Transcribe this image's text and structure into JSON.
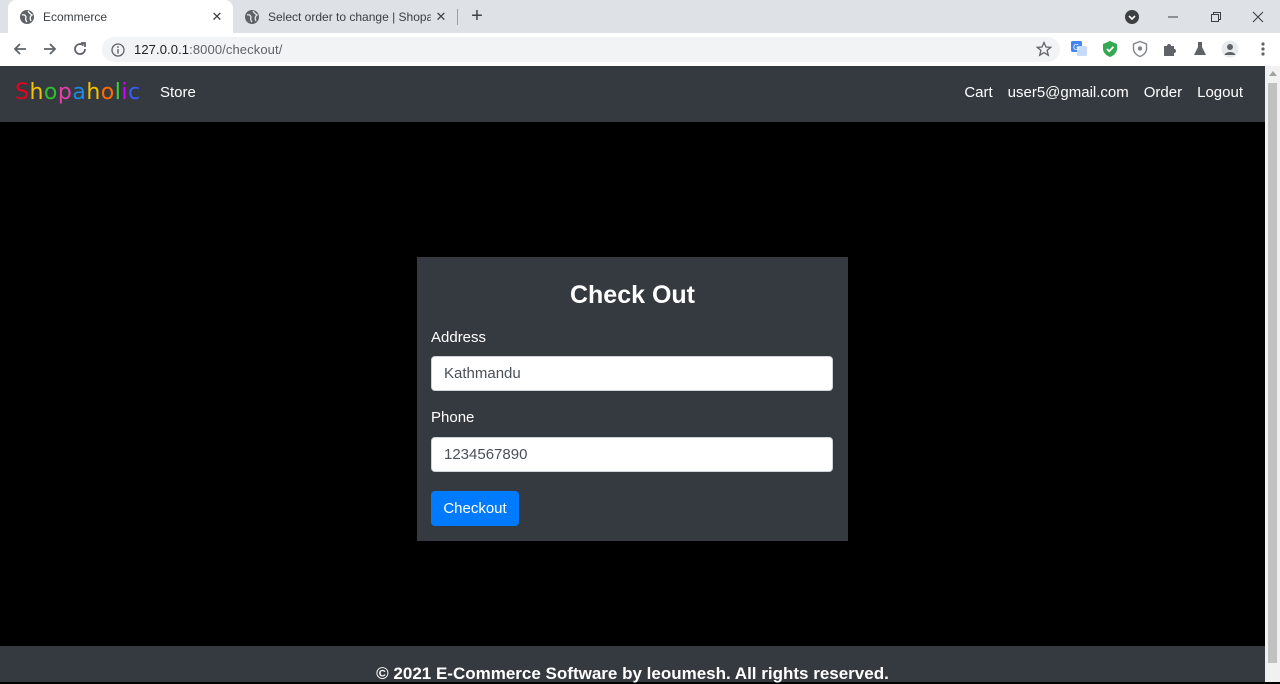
{
  "browser": {
    "tabs": [
      {
        "title": "Ecommerce",
        "active": true
      },
      {
        "title": "Select order to change | Shopaholic",
        "active": false
      }
    ],
    "address": {
      "host": "127.0.0.1",
      "rest": ":8000/checkout/"
    }
  },
  "navbar": {
    "brand_letters": [
      "S",
      "h",
      "o",
      "p",
      "a",
      "h",
      "o",
      "l",
      "i",
      "c"
    ],
    "brand_colors": [
      "#e8001c",
      "#f5c400",
      "#2fbf2f",
      "#e83ea7",
      "#1e88e5",
      "#f5c400",
      "#ff6a00",
      "#3ad13a",
      "#d500f9",
      "#3d5afe"
    ],
    "store": "Store",
    "cart": "Cart",
    "user": "user5@gmail.com",
    "order": "Order",
    "logout": "Logout"
  },
  "checkout": {
    "heading": "Check Out",
    "address_label": "Address",
    "address_value": "Kathmandu",
    "phone_label": "Phone",
    "phone_value": "1234567890",
    "button": "Checkout"
  },
  "footer": {
    "text": "© 2021 E-Commerce Software by leoumesh. All rights reserved."
  }
}
